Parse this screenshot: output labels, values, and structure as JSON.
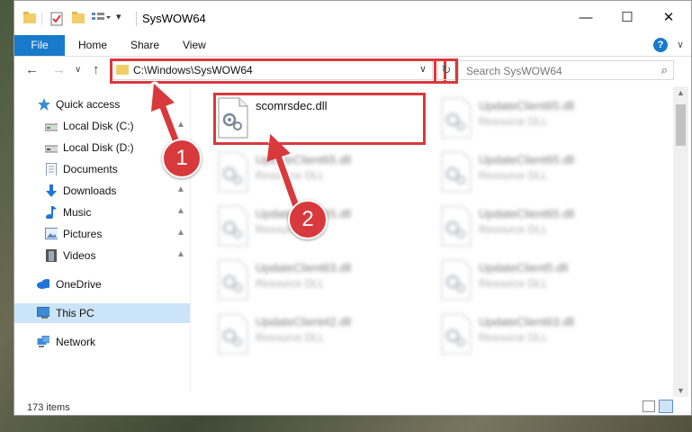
{
  "window": {
    "title": "SysWOW64",
    "controls": {
      "minimize": "—",
      "maximize": "☐",
      "close": "✕"
    }
  },
  "ribbon": {
    "file_tab": "File",
    "tabs": [
      "Home",
      "Share",
      "View"
    ],
    "expand": "∨",
    "help": "?"
  },
  "nav": {
    "back": "←",
    "forward": "→",
    "recent": "∨",
    "up": "↑",
    "address": "C:\\Windows\\SysWOW64",
    "address_dropdown": "∨",
    "refresh": "↻",
    "search_placeholder": "Search SysWOW64",
    "search_icon": "⌕"
  },
  "sidebar": {
    "items": [
      {
        "label": "Quick access",
        "icon": "star-icon",
        "color": "#3c8ad8",
        "pinned": false
      },
      {
        "label": "Local Disk (C:)",
        "icon": "drive-icon",
        "color": "#7a7a7a",
        "pinned": true
      },
      {
        "label": "Local Disk (D:)",
        "icon": "drive-icon",
        "color": "#7a7a7a",
        "pinned": false
      },
      {
        "label": "Documents",
        "icon": "documents-icon",
        "color": "#8a9bb0",
        "pinned": true
      },
      {
        "label": "Downloads",
        "icon": "downloads-icon",
        "color": "#1f74d6",
        "pinned": true
      },
      {
        "label": "Music",
        "icon": "music-icon",
        "color": "#1f74d6",
        "pinned": true
      },
      {
        "label": "Pictures",
        "icon": "pictures-icon",
        "color": "#5d88c0",
        "pinned": true
      },
      {
        "label": "Videos",
        "icon": "videos-icon",
        "color": "#555",
        "pinned": true
      },
      {
        "label": "OneDrive",
        "icon": "onedrive-icon",
        "color": "#1f74d6",
        "pinned": false
      },
      {
        "label": "This PC",
        "icon": "computer-icon",
        "color": "#3c8ad8",
        "pinned": false,
        "selected": true
      },
      {
        "label": "Network",
        "icon": "network-icon",
        "color": "#3c8ad8",
        "pinned": false
      }
    ],
    "pin_glyph": "📌"
  },
  "files": [
    {
      "name": "scomrsdec.dll",
      "type": "",
      "highlighted": true
    },
    {
      "name": "UpdateClient65.dll",
      "type": "Resource DLL"
    },
    {
      "name": "UpdateClient65.dll",
      "type": "Resource DLL"
    },
    {
      "name": "UpdateClient65.dll",
      "type": "Resource DLL"
    },
    {
      "name": "UpdateClient65.dll",
      "type": "Resource DLL"
    },
    {
      "name": "UpdateClient65.dll",
      "type": "Resource DLL"
    },
    {
      "name": "UpdateClient63.dll",
      "type": "Resource DLL"
    },
    {
      "name": "UpdateClient5.dll",
      "type": "Resource DLL"
    },
    {
      "name": "UpdateClient42.dll",
      "type": "Resource DLL"
    },
    {
      "name": "UpdateClient63.dll",
      "type": "Resource DLL"
    }
  ],
  "status": {
    "item_count": "173 items"
  },
  "callouts": [
    "1",
    "2"
  ],
  "colors": {
    "accent": "#1979ca",
    "highlight": "#d8393c",
    "selection": "#cce4f7"
  }
}
